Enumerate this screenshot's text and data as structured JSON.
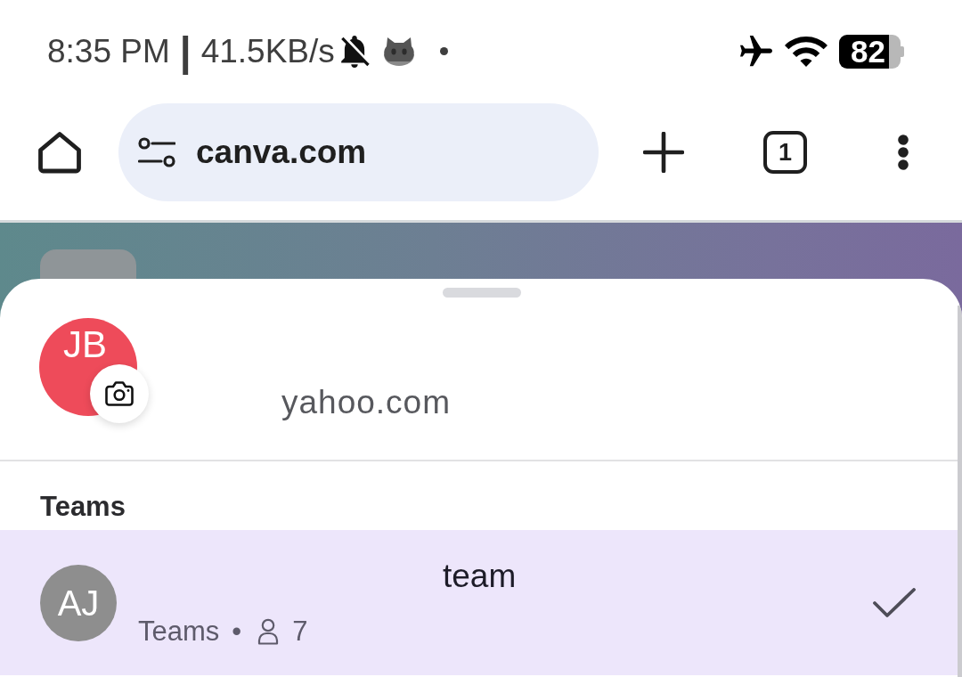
{
  "status_bar": {
    "time": "8:35 PM",
    "separator": "|",
    "speed": "41.5KB/s",
    "battery": "82"
  },
  "browser": {
    "url": "canva.com",
    "tab_count": "1"
  },
  "account": {
    "initials": "JB",
    "email": "yahoo.com"
  },
  "teams": {
    "heading": "Teams",
    "items": [
      {
        "initials": "AJ",
        "name": "team",
        "type": "Teams",
        "separator": "•",
        "members": "7",
        "selected": true
      }
    ]
  }
}
